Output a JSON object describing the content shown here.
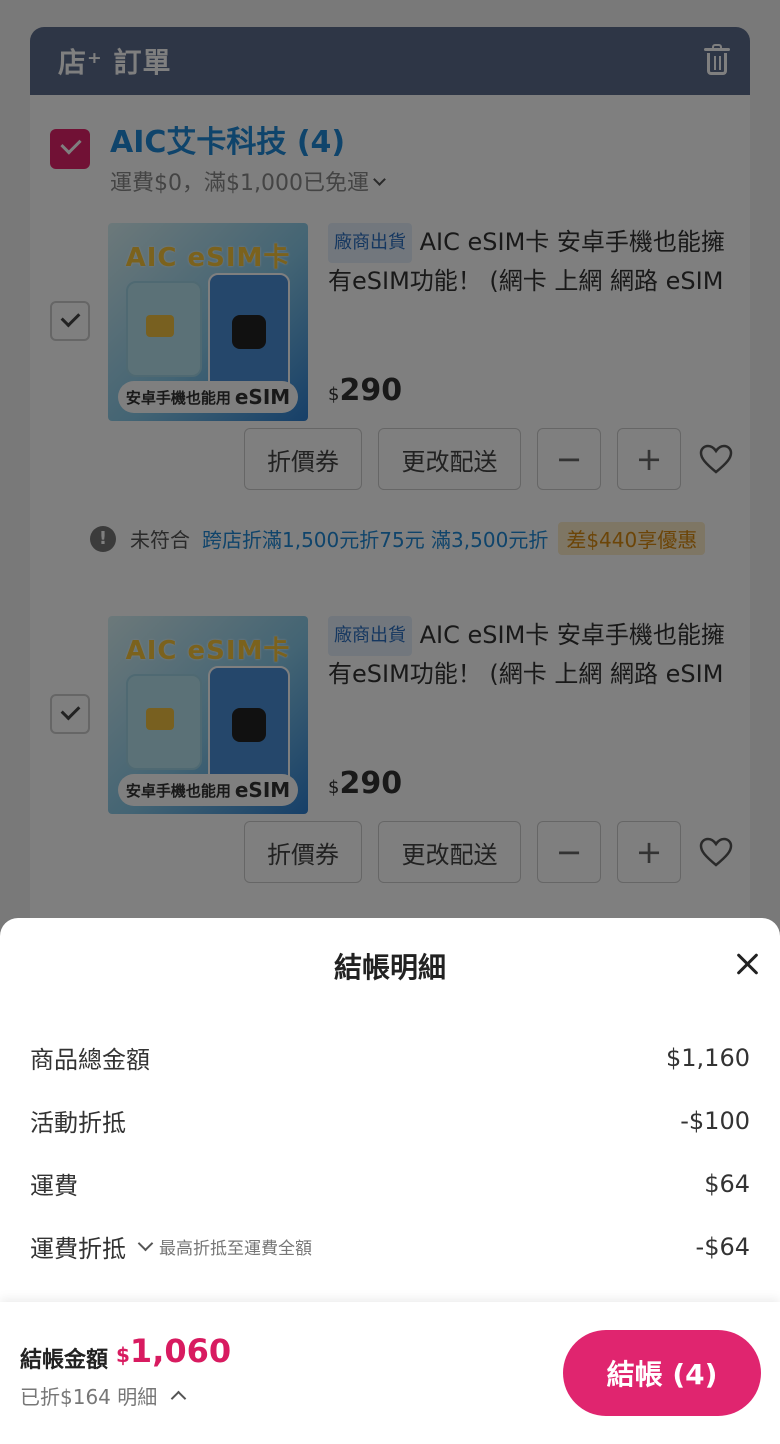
{
  "store": {
    "logo": "店⁺ 訂單",
    "seller_name": "AIC艾卡科技 (4)",
    "shipping_note": "運費$0，滿$1,000已免運"
  },
  "products": [
    {
      "badge": "廠商出貨",
      "name": "AIC eSIM卡 安卓手機也能擁有eSIM功能！ (網卡 上網 網路 eSIM 全球網路方案無限制)",
      "currency": "$",
      "price": "290",
      "thumb_title": "AIC eSIM卡",
      "thumb_banner_text": "安卓手機也能用",
      "thumb_banner_bold": "eSIM",
      "coupon_label": "折價券",
      "change_shipping_label": "更改配送",
      "minus": "−",
      "plus": "+"
    },
    {
      "badge": "廠商出貨",
      "name": "AIC eSIM卡 安卓手機也能擁有eSIM功能！ (網卡 上網 網路 eSIM 全球網路方案無限制)",
      "currency": "$",
      "price": "290",
      "thumb_title": "AIC eSIM卡",
      "thumb_banner_text": "安卓手機也能用",
      "thumb_banner_bold": "eSIM",
      "coupon_label": "折價券",
      "change_shipping_label": "更改配送",
      "minus": "−",
      "plus": "+"
    }
  ],
  "promo": {
    "icon": "!",
    "status": "未符合",
    "description": "跨店折滿1,500元折75元 滿3,500元折",
    "tag": "差$440享優惠"
  },
  "sheet": {
    "title": "結帳明細",
    "lines": [
      {
        "label": "商品總金額",
        "value": "$1,160"
      },
      {
        "label": "活動折抵",
        "value": "-$100"
      },
      {
        "label": "運費",
        "value": "$64"
      },
      {
        "label": "運費折抵",
        "value": "-$64",
        "note": "最高折抵至運費全額"
      }
    ]
  },
  "footer": {
    "total_label": "結帳金額",
    "currency": "$",
    "total_amount": "1,060",
    "discount_text": "已折$164 明細",
    "checkout_label": "結帳 (4)"
  },
  "colors": {
    "accent": "#e0256f",
    "header": "#5d6d8c",
    "link_blue": "#1e88d6"
  }
}
